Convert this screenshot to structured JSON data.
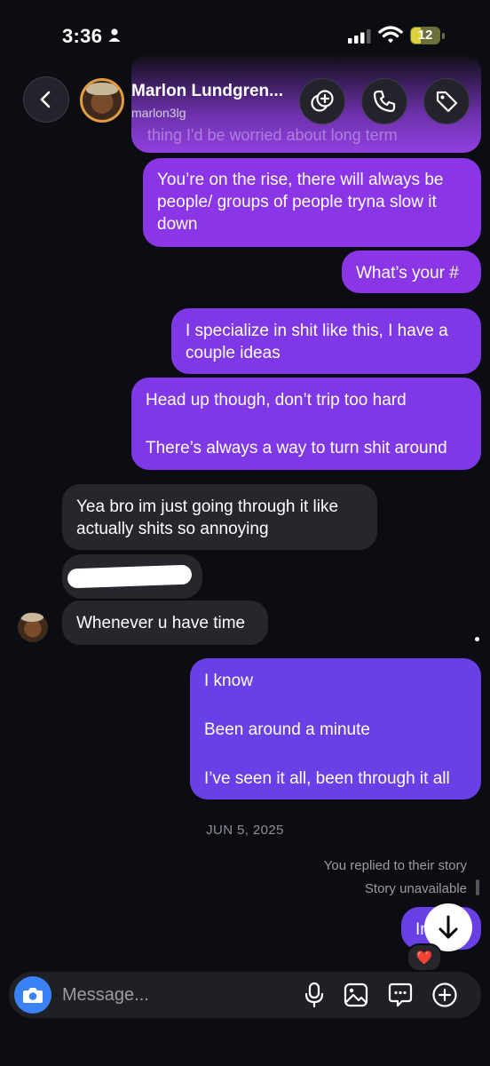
{
  "status_bar": {
    "time": "3:36",
    "battery": "12"
  },
  "header": {
    "contact_name": "Marlon Lundgren...",
    "contact_handle": "marlon3lg"
  },
  "thread": {
    "ghost_text": "thing I'd be worried about long term",
    "messages": [
      {
        "from": "me",
        "text": "You’re on the rise, there will always be people/ groups of people tryna slow it down"
      },
      {
        "from": "me",
        "text": "What’s your #"
      },
      {
        "from": "me",
        "text": "I specialize in shit like this, I have a couple ideas"
      },
      {
        "from": "me",
        "text": "Head up though, don’t trip too hard\n\nThere’s always a way to turn shit around"
      },
      {
        "from": "them",
        "text": "Yea bro im just going through it like actually shits so annoying"
      },
      {
        "from": "them",
        "text": "Whenever u have time"
      },
      {
        "from": "me",
        "text": "I know\n\nBeen around a minute\n\nI’ve seen it all, been through it all"
      },
      {
        "from": "me",
        "text": "In"
      }
    ],
    "date_separator": "JUN 5, 2025",
    "story_reply_note": "You replied to their story",
    "story_unavailable": "Story unavailable",
    "reaction_emoji": "❤️"
  },
  "composer": {
    "placeholder": "Message..."
  },
  "colors": {
    "background": "#0c0d12",
    "outgoing_bubble": "#8a35e6",
    "outgoing_bubble_blue": "#6840e6",
    "incoming_bubble": "#26272d",
    "camera_button": "#3b82f6"
  }
}
